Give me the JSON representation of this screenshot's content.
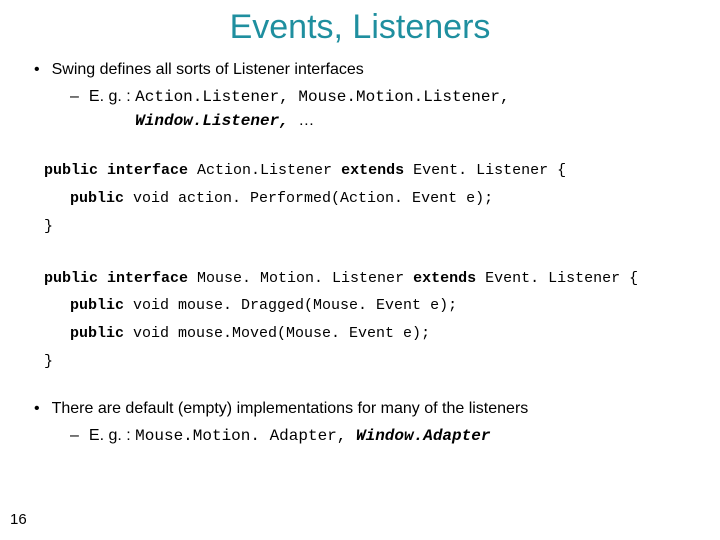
{
  "title": "Events, Listeners",
  "bullets": {
    "b1": "Swing defines all sorts of Listener interfaces",
    "b1a_prefix": "E. g. : ",
    "b1a_mono1": "Action.Listener, Mouse.Motion.Listener,",
    "b1a_mono2": "Window.Listener, ",
    "b1a_ellipsis": "…",
    "b2": "There are default (empty) implementations for many of the listeners",
    "b2a_prefix": "E. g. : ",
    "b2a_mono1": "Mouse.Motion. Adapter, ",
    "b2a_mono2": "Window.Adapter"
  },
  "code1": {
    "l1a": "public interface ",
    "l1b": "Action.Listener ",
    "l1c": "extends ",
    "l1d": "Event. Listener {",
    "l2a": "public ",
    "l2b": "void action. Performed(Action. Event e);",
    "l3": "}"
  },
  "code2": {
    "l1a": "public interface ",
    "l1b": "Mouse. Motion. Listener ",
    "l1c": "extends ",
    "l1d": "Event. Listener {",
    "l2a": "public ",
    "l2b": "void mouse. Dragged(Mouse. Event e);",
    "l3a": "public ",
    "l3b": "void mouse.Moved(Mouse. Event e);",
    "l4": "}"
  },
  "page_number": "16"
}
